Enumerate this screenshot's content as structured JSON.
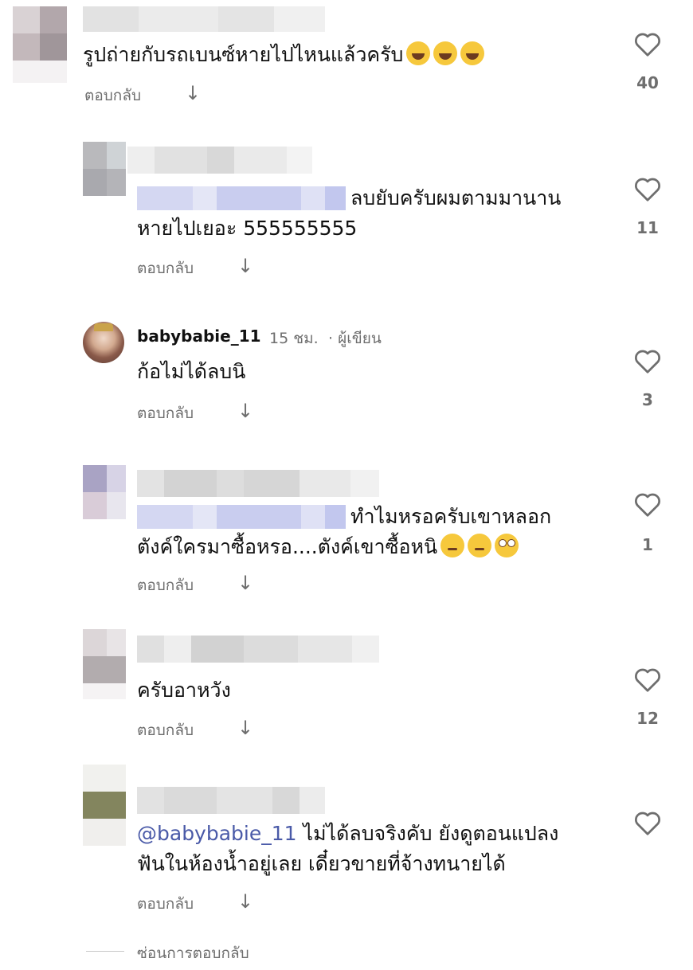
{
  "reply_label": "ตอบกลับ",
  "hide_replies_label": "ซ่อนการตอบกลับ",
  "comments": [
    {
      "text": "รูปถ่ายกับรถเบนซ์หายไปไหนแล้วครับ",
      "emojis": [
        "face-with-tears-of-joy",
        "face-with-tears-of-joy",
        "face-with-tears-of-joy"
      ],
      "likes": "40"
    },
    {
      "line1": "ลบยับครับผมตามมานาน",
      "line2": "หายไปเยอะ 555555555",
      "likes": "11"
    },
    {
      "username": "babybabie_11",
      "time": "15 ชม.",
      "role": "· ผู้เขียน",
      "text": "ก้อไม่ได้ลบนิ",
      "likes": "3"
    },
    {
      "line1": "ทำไมหรอครับเขาหลอก",
      "line2": "ตังค์ใครมาซื้อหรอ....ตังค์เขาซื้อหนิ",
      "emojis": [
        "thinking-face",
        "thinking-face",
        "face-with-rolling-eyes"
      ],
      "likes": "1"
    },
    {
      "text": "ครับอาหวัง",
      "likes": "12"
    },
    {
      "mention": "@babybabie_11",
      "line1": " ไม่ได้ลบจริงคับ ยังดูตอนแปลง",
      "line2": "ฟันในห้องน้ำอยู่เลย เดี๋ยวขายที่จ้างทนายได้",
      "likes": ""
    }
  ],
  "icons": {
    "like": "heart-outline-icon",
    "reply": "arrow-down-icon"
  },
  "colors": {
    "text": "#111111",
    "muted": "#6e6e6e",
    "mention": "#4a5aa8"
  }
}
